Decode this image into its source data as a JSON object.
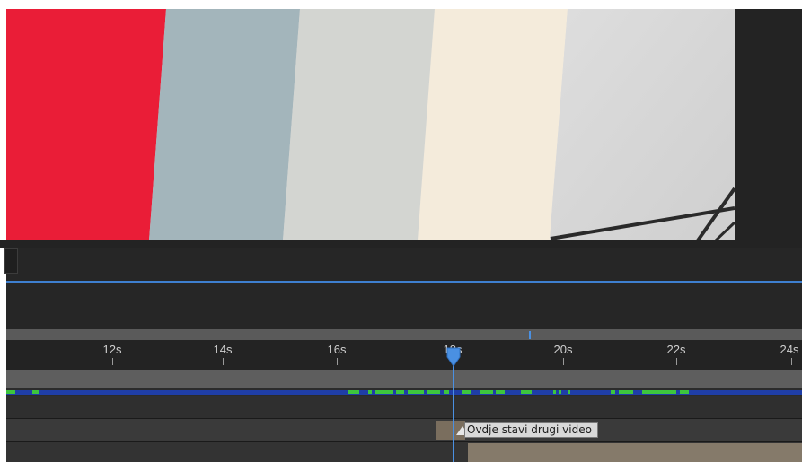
{
  "viewer": {
    "stripe_colors": [
      "#ea1d37",
      "#a3b5bb",
      "#d3d5d1",
      "#f4ebdb",
      "#dadada"
    ]
  },
  "timeline": {
    "ruler_labels": [
      "12s",
      "14s",
      "16s",
      "18s",
      "20s",
      "22s",
      "24s"
    ],
    "playhead_time": "18s",
    "colors": {
      "accent": "#4a90e2",
      "cache_rendered": "#3ec53e",
      "cache_background": "#1f3ea7",
      "layer_bar": "#857a6a"
    }
  },
  "marker": {
    "comment": "Ovdje stavi drugi video"
  },
  "icons": {
    "playhead": "playhead-icon",
    "marker": "marker-icon"
  }
}
